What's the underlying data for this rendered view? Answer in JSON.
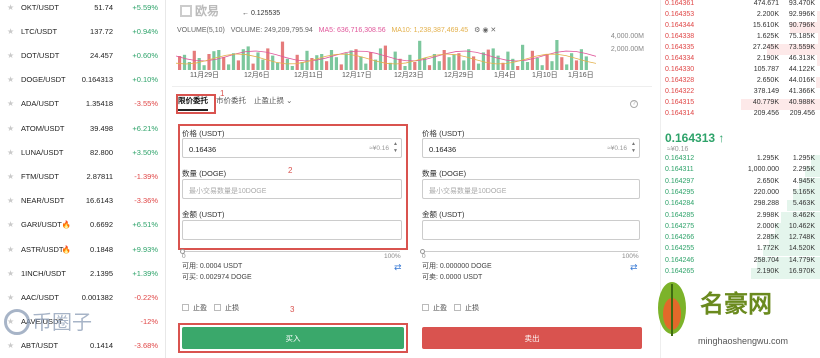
{
  "tickers": [
    {
      "symbol": "OKT/USDT",
      "price": "51.74",
      "change": "+5.59%",
      "dir": "up",
      "hot": false
    },
    {
      "symbol": "LTC/USDT",
      "price": "137.72",
      "change": "+0.94%",
      "dir": "up",
      "hot": false
    },
    {
      "symbol": "DOT/USDT",
      "price": "24.457",
      "change": "+0.60%",
      "dir": "up",
      "hot": false
    },
    {
      "symbol": "DOGE/USDT",
      "price": "0.164313",
      "change": "+0.10%",
      "dir": "up",
      "hot": false
    },
    {
      "symbol": "ADA/USDT",
      "price": "1.35418",
      "change": "-3.55%",
      "dir": "down",
      "hot": false
    },
    {
      "symbol": "ATOM/USDT",
      "price": "39.498",
      "change": "+6.21%",
      "dir": "up",
      "hot": false
    },
    {
      "symbol": "LUNA/USDT",
      "price": "82.800",
      "change": "+3.50%",
      "dir": "up",
      "hot": false
    },
    {
      "symbol": "FTM/USDT",
      "price": "2.87811",
      "change": "-1.39%",
      "dir": "down",
      "hot": false
    },
    {
      "symbol": "NEAR/USDT",
      "price": "16.6143",
      "change": "-3.36%",
      "dir": "down",
      "hot": false
    },
    {
      "symbol": "GARI/USDT",
      "price": "0.6692",
      "change": "+6.51%",
      "dir": "up",
      "hot": true
    },
    {
      "symbol": "ASTR/USDT",
      "price": "0.1848",
      "change": "+9.93%",
      "dir": "up",
      "hot": true
    },
    {
      "symbol": "1INCH/USDT",
      "price": "2.1395",
      "change": "+1.39%",
      "dir": "up",
      "hot": false
    },
    {
      "symbol": "AAC/USDT",
      "price": "0.001382",
      "change": "-0.22%",
      "dir": "down",
      "hot": false
    },
    {
      "symbol": "AAVE/USDT",
      "price": "",
      "change": "-12%",
      "dir": "down",
      "hot": false
    },
    {
      "symbol": "ABT/USDT",
      "price": "0.1414",
      "change": "-3.68%",
      "dir": "down",
      "hot": false
    }
  ],
  "chart": {
    "logo_text": "欧易",
    "price_line": "← 0.125535",
    "vol_label": "VOLUME(5,10)",
    "vol_value": "VOLUME: 249,209,795.94",
    "ma5": "MA5: 636,716,308.56",
    "ma10": "MA10: 1,238,387,469.45",
    "axis_r": [
      "4,000.00M",
      "2,000.00M"
    ],
    "dates": [
      "11月29日",
      "12月6日",
      "12月11日",
      "12月17日",
      "12月23日",
      "12月29日",
      "1月4日",
      "1月10日",
      "1月16日"
    ]
  },
  "order": {
    "tabs": [
      "限价委托",
      "市价委托",
      "止盈止损"
    ],
    "buy": {
      "price_label": "价格 (USDT)",
      "price_value": "0.16436",
      "price_side": "≈¥0.16",
      "qty_label": "数量 (DOGE)",
      "qty_placeholder": "最小交易数量是10DOGE",
      "amount_label": "金额 (USDT)",
      "pct_min": "0",
      "pct_max": "100%",
      "available": "可用: 0.0004 USDT",
      "can_buy": "可买: 0.002974 DOGE",
      "take_profit": "止盈",
      "stop_loss": "止损",
      "button": "买入"
    },
    "sell": {
      "price_label": "价格 (USDT)",
      "price_value": "0.16436",
      "price_side": "≈¥0.16",
      "qty_label": "数量 (DOGE)",
      "qty_placeholder": "最小交易数量是10DOGE",
      "amount_label": "金额 (USDT)",
      "pct_min": "0",
      "pct_max": "100%",
      "available": "可用: 0.000000 DOGE",
      "can_sell": "可卖: 0.0000 USDT",
      "take_profit": "止盈",
      "stop_loss": "止损",
      "button": "卖出"
    },
    "annotations": [
      "1",
      "2",
      "3"
    ]
  },
  "book": {
    "asks": [
      [
        "0.164361",
        "474.671",
        "93.470K"
      ],
      [
        "0.164353",
        "2.200K",
        "92.996K"
      ],
      [
        "0.164344",
        "15.610K",
        "90.796K"
      ],
      [
        "0.164338",
        "1.625K",
        "75.185K"
      ],
      [
        "0.164335",
        "27.245K",
        "73.559K"
      ],
      [
        "0.164334",
        "2.190K",
        "46.313K"
      ],
      [
        "0.164330",
        "105.787",
        "44.122K"
      ],
      [
        "0.164328",
        "2.650K",
        "44.016K"
      ],
      [
        "0.164322",
        "378.149",
        "41.366K"
      ],
      [
        "0.164315",
        "40.779K",
        "40.988K"
      ],
      [
        "0.164314",
        "209.456",
        "209.456"
      ]
    ],
    "mid_price": "0.164313 ↑",
    "mid_sub": "≈¥0.16",
    "bids": [
      [
        "0.164312",
        "1.295K",
        "1.295K"
      ],
      [
        "0.164311",
        "1,000.000",
        "2.295K"
      ],
      [
        "0.164297",
        "2.650K",
        "4.945K"
      ],
      [
        "0.164295",
        "220.000",
        "5.165K"
      ],
      [
        "0.164284",
        "298.288",
        "5.463K"
      ],
      [
        "0.164285",
        "2.998K",
        "8.462K"
      ],
      [
        "0.164275",
        "2.000K",
        "10.462K"
      ],
      [
        "0.164266",
        "2.285K",
        "12.748K"
      ],
      [
        "0.164255",
        "1.772K",
        "14.520K"
      ],
      [
        "0.164246",
        "258.704",
        "14.779K"
      ],
      [
        "0.164265",
        "2.190K",
        "16.970K"
      ]
    ]
  },
  "watermarks": {
    "left": "币圈子",
    "right": "名豪网",
    "right_url": "minghaoshengwu.com"
  }
}
